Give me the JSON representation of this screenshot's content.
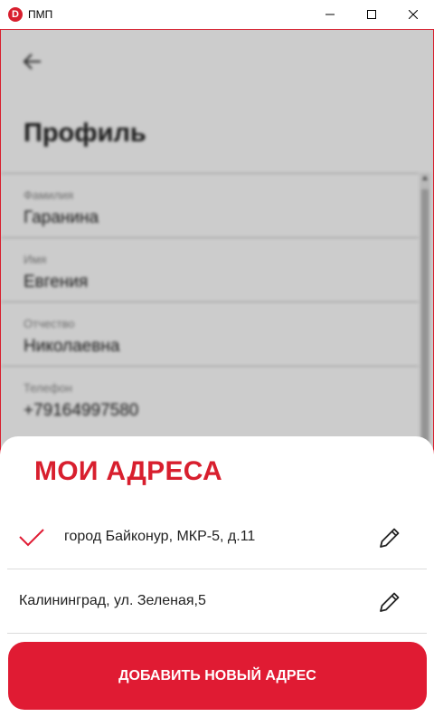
{
  "window": {
    "logo_letter": "D",
    "title": "ПМП"
  },
  "profile": {
    "title": "Профиль",
    "fields": [
      {
        "label": "Фамилия",
        "value": "Гаранина"
      },
      {
        "label": "Имя",
        "value": "Евгения"
      },
      {
        "label": "Отчество",
        "value": "Николаевна"
      },
      {
        "label": "Телефон",
        "value": "+79164997580"
      }
    ]
  },
  "addresses": {
    "title": "МОИ АДРЕСА",
    "items": [
      {
        "text": "город Байконур, МКР-5, д.11",
        "selected": true
      },
      {
        "text": "Калининград, ул. Зеленая,5",
        "selected": false
      }
    ],
    "add_button_label": "ДОБАВИТЬ НОВЫЙ АДРЕС"
  },
  "colors": {
    "accent": "#e01b33",
    "title_red": "#d81f2e"
  },
  "icons": {
    "back": "arrow-left-icon",
    "check": "check-icon",
    "edit": "pencil-icon",
    "minimize": "minimize-icon",
    "maximize": "maximize-icon",
    "close": "close-icon"
  }
}
